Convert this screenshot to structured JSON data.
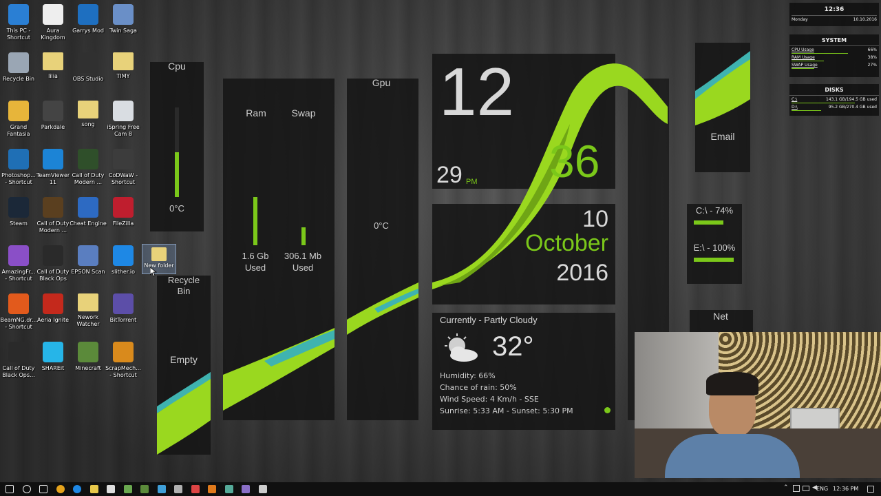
{
  "desktop_icons": [
    {
      "label": "This PC - Shortcut",
      "icon": "computer-icon",
      "color": "#2a7fd4"
    },
    {
      "label": "Aura Kingdom",
      "icon": "document-icon",
      "color": "#eeeeee"
    },
    {
      "label": "Garrys Mod",
      "icon": "gmod-icon",
      "color": "#1e6fc0"
    },
    {
      "label": "Twin Saga",
      "icon": "game-character-icon",
      "color": "#6a8fc7"
    },
    {
      "label": "Recycle Bin",
      "icon": "recycle-bin-icon",
      "color": "#9aa6b4"
    },
    {
      "label": "lilia",
      "icon": "folder-icon",
      "color": "#e8d27a"
    },
    {
      "label": "OBS Studio",
      "icon": "obs-icon",
      "color": "#303030"
    },
    {
      "label": "TIMY",
      "icon": "folder-icon",
      "color": "#e8d27a"
    },
    {
      "label": "Grand Fantasia",
      "icon": "game-character-icon",
      "color": "#e7b53a"
    },
    {
      "label": "Parkdale",
      "icon": "speedometer-icon",
      "color": "#444444"
    },
    {
      "label": "song",
      "icon": "folder-icon",
      "color": "#e8d27a"
    },
    {
      "label": "iSpring Free Cam 8",
      "icon": "camera-icon",
      "color": "#d9dde2"
    },
    {
      "label": "Photoshop... - Shortcut",
      "icon": "photoshop-icon",
      "color": "#1f6fb5"
    },
    {
      "label": "TeamViewer 11",
      "icon": "teamviewer-icon",
      "color": "#1c84d6"
    },
    {
      "label": "Call of Duty Modern ...",
      "icon": "cod-icon",
      "color": "#2f4f2a"
    },
    {
      "label": "CoDWaW - Shortcut",
      "icon": "star-icon",
      "color": "#3c3c3c"
    },
    {
      "label": "Steam",
      "icon": "steam-icon",
      "color": "#1b2838"
    },
    {
      "label": "Call of Duty Modern ...",
      "icon": "cod-icon",
      "color": "#5a3f1f"
    },
    {
      "label": "Cheat Engine",
      "icon": "cheat-engine-icon",
      "color": "#2d6ac2"
    },
    {
      "label": "FileZilla",
      "icon": "filezilla-icon",
      "color": "#bf1e2e"
    },
    {
      "label": "AmazingFr... - Shortcut",
      "icon": "app-icon",
      "color": "#8a4fc7"
    },
    {
      "label": "Call of Duty Black Ops",
      "icon": "skull-icon",
      "color": "#2a2a2a"
    },
    {
      "label": "EPSON Scan",
      "icon": "scanner-icon",
      "color": "#5a7ec0"
    },
    {
      "label": "slither.io",
      "icon": "ie-icon",
      "color": "#1e88e5"
    },
    {
      "label": "BeamNG.dr... - Shortcut",
      "icon": "beamng-icon",
      "color": "#e25a1c"
    },
    {
      "label": "Aeria Ignite",
      "icon": "flame-icon",
      "color": "#c4291c"
    },
    {
      "label": "Nework Watcher",
      "icon": "folder-icon",
      "color": "#e8d27a"
    },
    {
      "label": "BitTorrent",
      "icon": "bittorrent-icon",
      "color": "#5c4ea8"
    },
    {
      "label": "Call of Duty Black Ops...",
      "icon": "skull-icon",
      "color": "#2a2a2a"
    },
    {
      "label": "SHAREit",
      "icon": "shareit-icon",
      "color": "#26b5e8"
    },
    {
      "label": "Minecraft",
      "icon": "minecraft-icon",
      "color": "#5b8a3a"
    },
    {
      "label": "ScrapMech... - Shortcut",
      "icon": "gear-icon",
      "color": "#d98a1c"
    }
  ],
  "selected_icon": {
    "label": "New folder",
    "icon": "folder-icon"
  },
  "cpu": {
    "title": "Cpu",
    "temp": "0°C",
    "usage_fraction": 0.5
  },
  "memory": {
    "ram_title": "Ram",
    "swap_title": "Swap",
    "ram_value": "1.6 Gb",
    "ram_sub": "Used",
    "swap_value": "306.1 Mb",
    "swap_sub": "Used"
  },
  "gpu": {
    "title": "Gpu",
    "temp": "0°C"
  },
  "recycle": {
    "title": "Recycle Bin",
    "status": "Empty"
  },
  "clock": {
    "hour": "12",
    "minute": "36",
    "second": "29",
    "ampm": "PM"
  },
  "date": {
    "day": "10",
    "month": "October",
    "year": "2016"
  },
  "weather": {
    "condition": "Currently - Partly Cloudy",
    "temp": "32°",
    "humidity": "Humidity: 66%",
    "rain": "Chance of rain: 50%",
    "wind": "Wind Speed: 4 Km/h - SSE",
    "sun": "Sunrise: 5:33 AM - Sunset: 5:30 PM"
  },
  "email": {
    "label": "Email"
  },
  "drives": {
    "c_label": "C:\\ - 74%",
    "e_label": "E:\\ - 100%",
    "c_fraction": 0.74,
    "e_fraction": 1.0
  },
  "net": {
    "label": "Net"
  },
  "system_widget": {
    "time": "12:36",
    "day": "Monday",
    "date": "10.10.2016",
    "system_title": "SYSTEM",
    "rows": [
      {
        "label": "CPU Usage",
        "value": "66%",
        "fraction": 0.66
      },
      {
        "label": "RAM Usage",
        "value": "38%",
        "fraction": 0.38
      },
      {
        "label": "SWAP Usage",
        "value": "27%",
        "fraction": 0.27
      }
    ],
    "disks_title": "DISKS",
    "disks": [
      {
        "label": "C:\\",
        "value": "143.1 GB/194.5 GB used",
        "fraction": 0.74
      },
      {
        "label": "D:\\",
        "value": "95.2 GB/270.4 GB used",
        "fraction": 0.35
      }
    ]
  },
  "taskbar": {
    "language": "ENG",
    "time": "12:36 PM",
    "pinned": [
      "start-icon",
      "search-icon",
      "task-view-icon",
      "chrome-icon",
      "edge-icon",
      "file-explorer-icon",
      "store-icon",
      "app-icon",
      "minecraft-icon",
      "app-icon",
      "app-icon",
      "app-icon",
      "app-icon",
      "app-icon",
      "app-icon",
      "steam-icon"
    ]
  },
  "colors": {
    "accent": "#7bc81a",
    "panel": "#161616",
    "taskbar": "#101010"
  }
}
